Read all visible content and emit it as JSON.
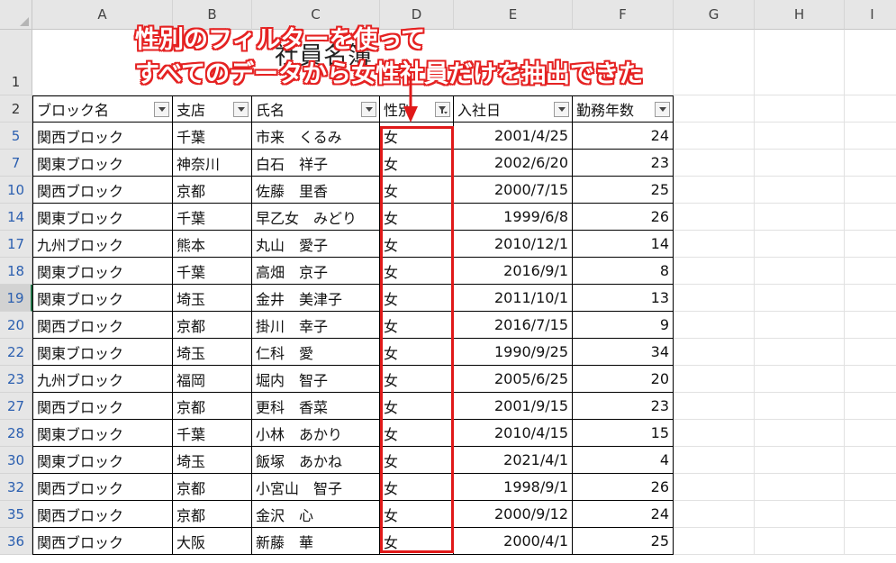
{
  "columns": [
    "A",
    "B",
    "C",
    "D",
    "E",
    "F",
    "G",
    "H",
    "I"
  ],
  "title_row": {
    "row_number": "1",
    "title": "社員名簿"
  },
  "annotation": {
    "line1": "性別のフィルターを使って",
    "line2": "すべてのデータから女性社員だけを抽出できた"
  },
  "header_row": {
    "row_number": "2",
    "headers": [
      "ブロック名",
      "支店",
      "氏名",
      "性別",
      "入社日",
      "勤務年数"
    ]
  },
  "filter_state": {
    "active_filter_column": "性別",
    "filtered_value": "女"
  },
  "rows": [
    {
      "row": "5",
      "block": "関西ブロック",
      "branch": "千葉",
      "name": "市来　くるみ",
      "gender": "女",
      "date": "2001/4/25",
      "years": "24"
    },
    {
      "row": "7",
      "block": "関東ブロック",
      "branch": "神奈川",
      "name": "白石　祥子",
      "gender": "女",
      "date": "2002/6/20",
      "years": "23"
    },
    {
      "row": "10",
      "block": "関西ブロック",
      "branch": "京都",
      "name": "佐藤　里香",
      "gender": "女",
      "date": "2000/7/15",
      "years": "25"
    },
    {
      "row": "14",
      "block": "関東ブロック",
      "branch": "千葉",
      "name": "早乙女　みどり",
      "gender": "女",
      "date": "1999/6/8",
      "years": "26"
    },
    {
      "row": "17",
      "block": "九州ブロック",
      "branch": "熊本",
      "name": "丸山　愛子",
      "gender": "女",
      "date": "2010/12/1",
      "years": "14"
    },
    {
      "row": "18",
      "block": "関東ブロック",
      "branch": "千葉",
      "name": "高畑　京子",
      "gender": "女",
      "date": "2016/9/1",
      "years": "8"
    },
    {
      "row": "19",
      "block": "関東ブロック",
      "branch": "埼玉",
      "name": "金井　美津子",
      "gender": "女",
      "date": "2011/10/1",
      "years": "13"
    },
    {
      "row": "20",
      "block": "関西ブロック",
      "branch": "京都",
      "name": "掛川　幸子",
      "gender": "女",
      "date": "2016/7/15",
      "years": "9"
    },
    {
      "row": "22",
      "block": "関東ブロック",
      "branch": "埼玉",
      "name": "仁科　愛",
      "gender": "女",
      "date": "1990/9/25",
      "years": "34"
    },
    {
      "row": "23",
      "block": "九州ブロック",
      "branch": "福岡",
      "name": "堀内　智子",
      "gender": "女",
      "date": "2005/6/25",
      "years": "20"
    },
    {
      "row": "27",
      "block": "関西ブロック",
      "branch": "京都",
      "name": "更科　香菜",
      "gender": "女",
      "date": "2001/9/15",
      "years": "23"
    },
    {
      "row": "28",
      "block": "関東ブロック",
      "branch": "千葉",
      "name": "小林　あかり",
      "gender": "女",
      "date": "2010/4/15",
      "years": "15"
    },
    {
      "row": "30",
      "block": "関東ブロック",
      "branch": "埼玉",
      "name": "飯塚　あかね",
      "gender": "女",
      "date": "2021/4/1",
      "years": "4"
    },
    {
      "row": "32",
      "block": "関西ブロック",
      "branch": "京都",
      "name": "小宮山　智子",
      "gender": "女",
      "date": "1998/9/1",
      "years": "26"
    },
    {
      "row": "35",
      "block": "関西ブロック",
      "branch": "京都",
      "name": "金沢　心",
      "gender": "女",
      "date": "2000/9/12",
      "years": "24"
    },
    {
      "row": "36",
      "block": "関西ブロック",
      "branch": "大阪",
      "name": "新藤　華",
      "gender": "女",
      "date": "2000/4/1",
      "years": "25"
    }
  ],
  "selected_row": "19",
  "colors": {
    "accent_red": "#e52222",
    "row_number_blue": "#2b5fb0",
    "header_bg": "#e6e6e6"
  }
}
